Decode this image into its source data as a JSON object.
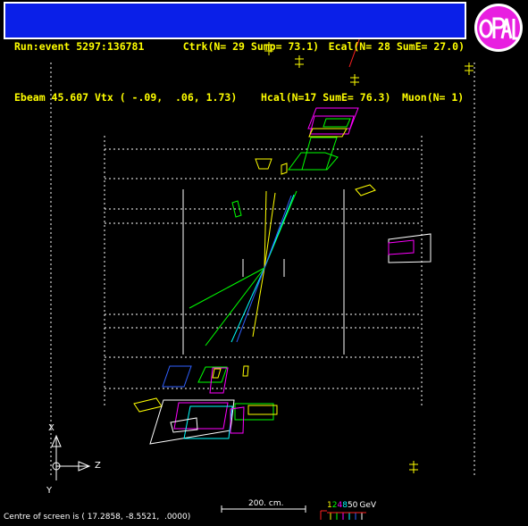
{
  "header": {
    "row1": {
      "run": "Run:event 5297:136781",
      "ctrk": "Ctrk(N= 29 Sump= 73.1)",
      "ecal": "Ecal(N= 28 SumE= 27.0)"
    },
    "row2": {
      "ebeam": "Ebeam 45.607 Vtx ( -.09,  .06, 1.73)",
      "hcal": "Hcal(N=17 SumE= 76.3)",
      "muon": "Muon(N= 1)"
    }
  },
  "logo": {
    "text": "OPAL"
  },
  "axes": {
    "x": "X",
    "y": "Y",
    "z": "Z"
  },
  "scale": {
    "label": "200. cm."
  },
  "energy": {
    "numbers": [
      "1",
      "2",
      "4",
      "8",
      "50"
    ],
    "unit": "GeV",
    "colors": [
      "#ffff00",
      "#00ff00",
      "#ff00ff",
      "#00ffff",
      "#ffffff"
    ]
  },
  "footer": {
    "centre": "Centre of screen is ( 17.2858, -8.5521,  .0000)"
  },
  "colors": {
    "background": "#000000",
    "header_bg": "#0a1fe8",
    "text": "#ffff00",
    "track_green": "#00ff00",
    "track_cyan": "#00ffff",
    "track_blue": "#3060ff",
    "calo_magenta": "#ff00ff",
    "calo_yellow": "#ffff00",
    "muon_red": "#ff2020"
  }
}
